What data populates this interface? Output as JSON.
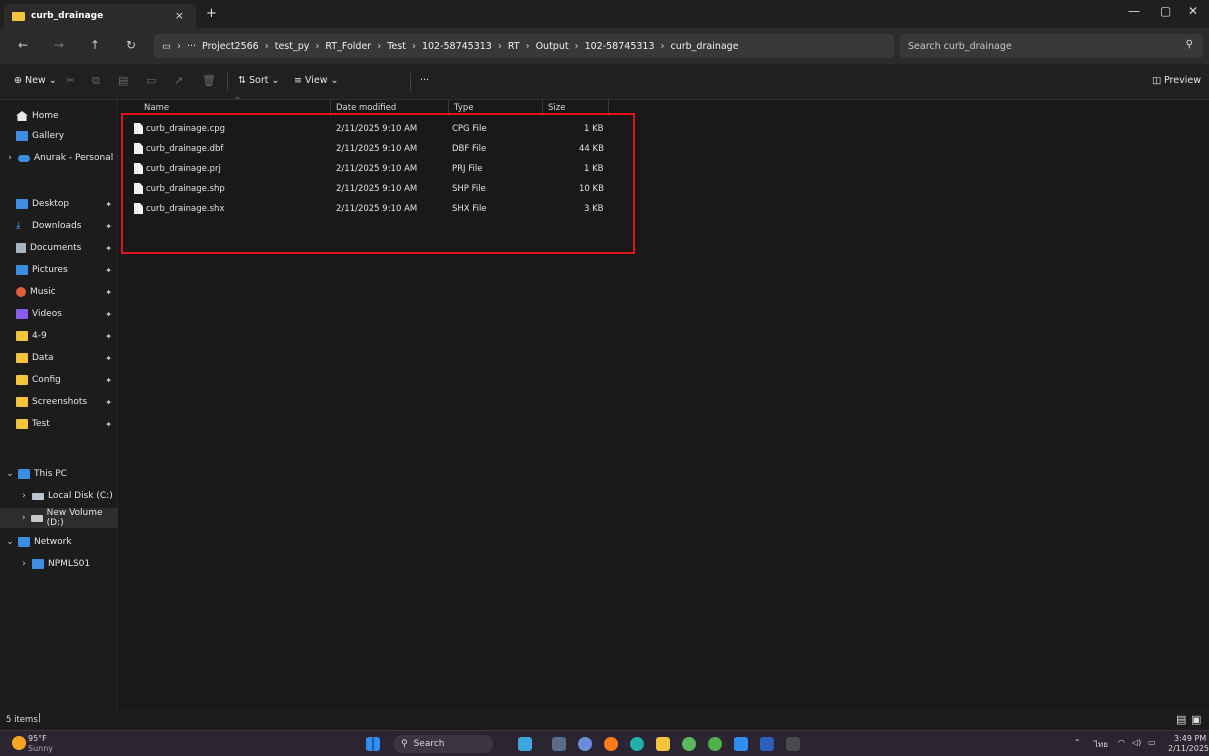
{
  "tab": {
    "title": "curb_drainage",
    "close": "×",
    "new": "+"
  },
  "window_controls": {
    "minimize": "—",
    "maximize": "▢",
    "close": "✕"
  },
  "address": {
    "ellipsis": "···",
    "crumbs": [
      "Project2566",
      "test_py",
      "RT_Folder",
      "Test",
      "102-58745313",
      "RT",
      "Output",
      "102-58745313",
      "curb_drainage"
    ]
  },
  "search": {
    "placeholder": "Search curb_drainage"
  },
  "toolbar": {
    "new_label": "New",
    "sort_label": "Sort",
    "view_label": "View",
    "more_label": "···",
    "preview_label": "Preview"
  },
  "sidebar": {
    "home": "Home",
    "gallery": "Gallery",
    "onedrive": "Anurak - Personal",
    "pinned": [
      "Desktop",
      "Downloads",
      "Documents",
      "Pictures",
      "Music",
      "Videos",
      "4-9",
      "Data",
      "Config",
      "Screenshots",
      "Test"
    ],
    "thispc": "This PC",
    "localdisk": "Local Disk (C:)",
    "newvolume": "New Volume (D:)",
    "network": "Network",
    "npmls": "NPMLS01"
  },
  "columns": {
    "name": "Name",
    "date": "Date modified",
    "type": "Type",
    "size": "Size"
  },
  "files": [
    {
      "name": "curb_drainage.cpg",
      "date": "2/11/2025 9:10 AM",
      "type": "CPG File",
      "size": "1 KB"
    },
    {
      "name": "curb_drainage.dbf",
      "date": "2/11/2025 9:10 AM",
      "type": "DBF File",
      "size": "44 KB"
    },
    {
      "name": "curb_drainage.prj",
      "date": "2/11/2025 9:10 AM",
      "type": "PRJ File",
      "size": "1 KB"
    },
    {
      "name": "curb_drainage.shp",
      "date": "2/11/2025 9:10 AM",
      "type": "SHP File",
      "size": "10 KB"
    },
    {
      "name": "curb_drainage.shx",
      "date": "2/11/2025 9:10 AM",
      "type": "SHX File",
      "size": "3 KB"
    }
  ],
  "status": {
    "count": "5 items"
  },
  "taskbar": {
    "weather_temp": "95°F",
    "weather_desc": "Sunny",
    "search": "Search",
    "lang": "ไทย",
    "time": "3:49 PM",
    "date": "2/11/2025"
  }
}
